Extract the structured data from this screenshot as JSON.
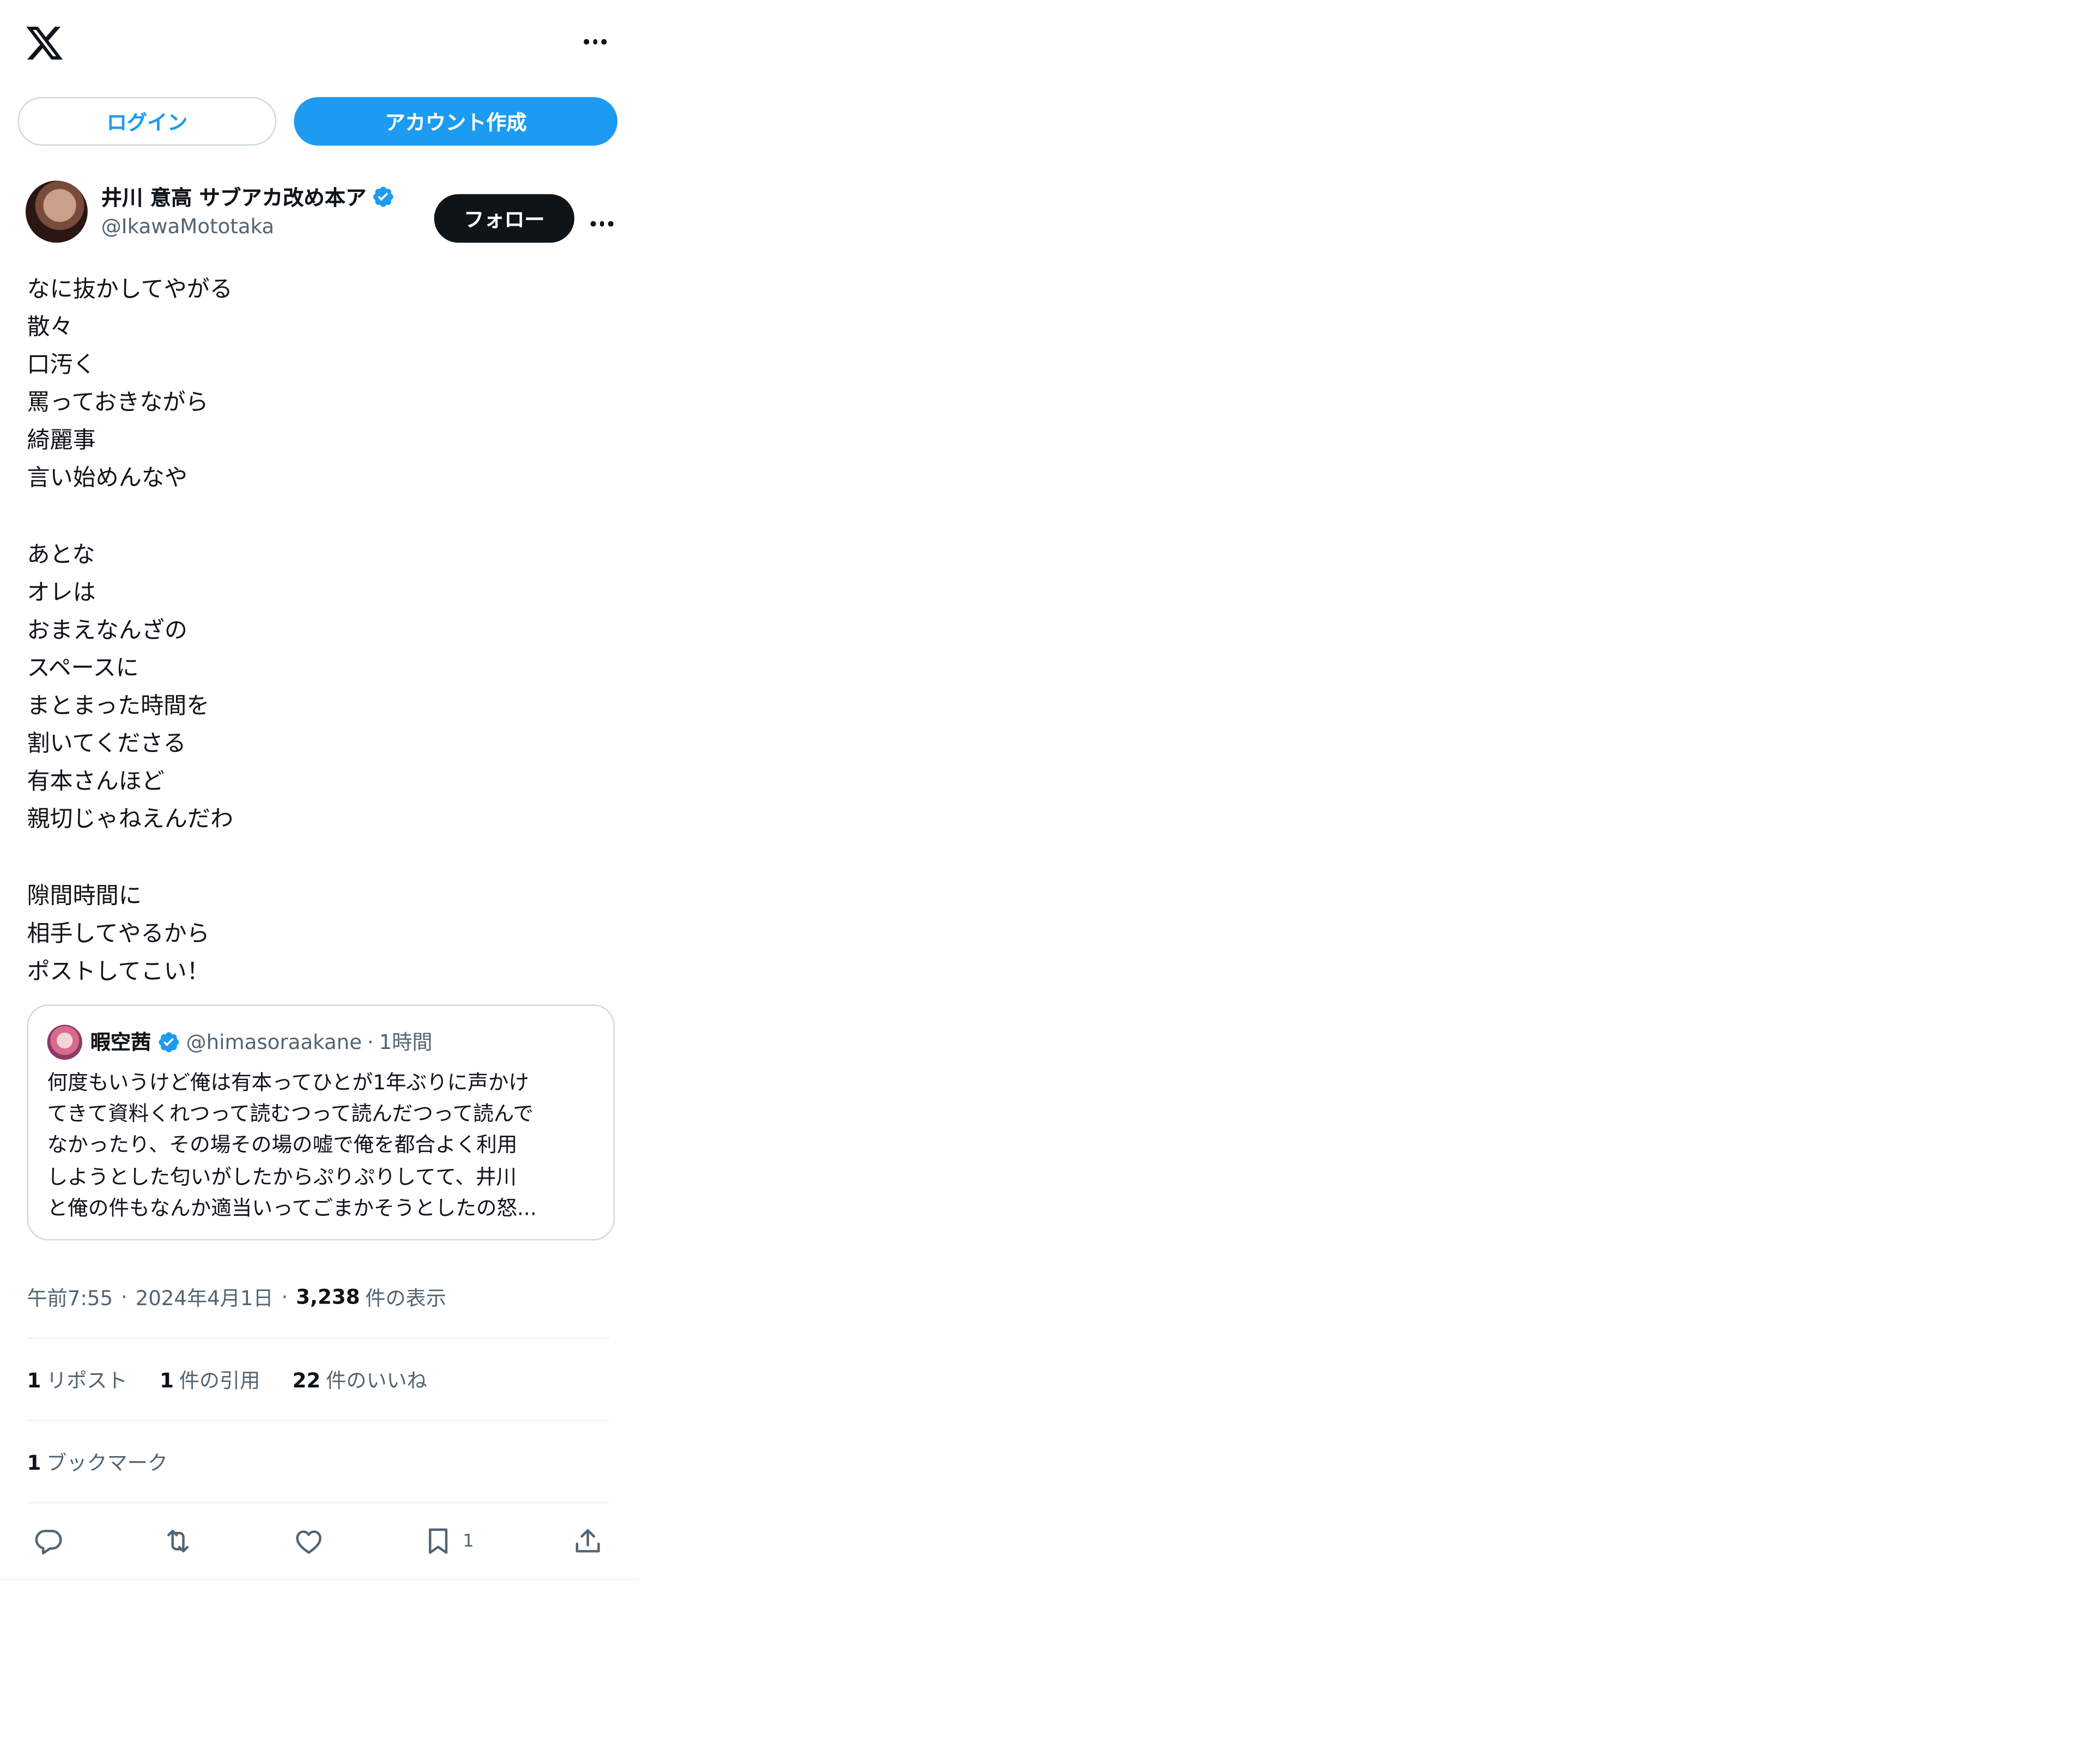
{
  "header": {
    "logo_icon": "x-logo-icon",
    "more_icon": "more-horizontal-icon"
  },
  "auth": {
    "login_label": "ログイン",
    "signup_label": "アカウント作成"
  },
  "tweet": {
    "author": {
      "display_name": "井川 意高 サブアカ改め本ア",
      "handle": "@IkawaMototaka",
      "verified": true,
      "follow_label": "フォロー"
    },
    "body_lines": [
      "なに抜かしてやがる",
      "散々",
      "口汚く",
      "罵っておきながら",
      "綺麗事",
      "言い始めんなや",
      "",
      "あとな",
      "オレは",
      "おまえなんざの",
      "スペースに",
      "まとまった時間を",
      "割いてくださる",
      "有本さんほど",
      "親切じゃねえんだわ",
      "",
      "隙間時間に",
      "相手してやるから",
      "ポストしてこい！"
    ],
    "quote": {
      "display_name": "暇空茜",
      "handle": "@himasoraakane",
      "separator": "·",
      "time": "1時間",
      "text_lines": [
        "何度もいうけど俺は有本ってひとが1年ぶりに声かけ",
        "てきて資料くれつって読むつって読んだつって読んで",
        "なかったり、その場その場の嘘で俺を都合よく利用",
        "しようとした匂いがしたからぷりぷりしてて、井川",
        "と俺の件もなんか適当いってごまかそうとしたの怒..."
      ]
    },
    "meta": {
      "time": "午前7:55",
      "sep": "·",
      "date": "2024年4月1日",
      "views_count": "3,238",
      "views_label": "件の表示"
    },
    "stats": {
      "reposts_count": "1",
      "reposts_label": "リポスト",
      "quotes_count": "1",
      "quotes_label": "件の引用",
      "likes_count": "22",
      "likes_label": "件のいいね",
      "bookmarks_count": "1",
      "bookmarks_label": "ブックマーク"
    },
    "actions": {
      "reply_icon": "reply-icon",
      "repost_icon": "repost-icon",
      "like_icon": "heart-icon",
      "bookmark_icon": "bookmark-icon",
      "bookmark_count": "1",
      "share_icon": "share-icon"
    }
  },
  "colors": {
    "accent": "#1d9bf0",
    "text": "#0f1419",
    "muted": "#536471",
    "border": "#cfd9de"
  }
}
